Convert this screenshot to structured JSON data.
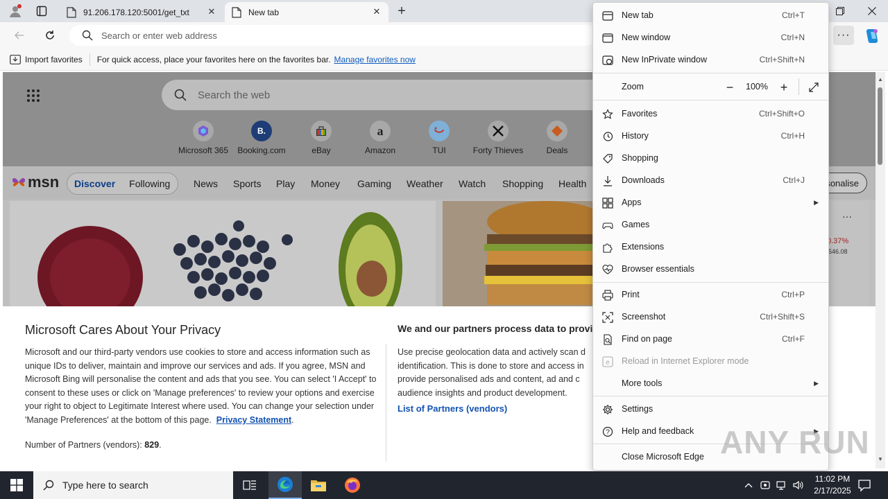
{
  "browser": {
    "tabs": [
      {
        "title": "91.206.178.120:5001/get_txt",
        "active": false
      },
      {
        "title": "New tab",
        "active": true
      }
    ],
    "address_placeholder": "Search or enter web address",
    "favorites_bar": {
      "import_label": "Import favorites",
      "hint_text": "For quick access, place your favorites here on the favorites bar.",
      "manage_link": "Manage favorites now"
    }
  },
  "msn": {
    "search_placeholder": "Search the web",
    "quick_links": [
      {
        "label": "Microsoft 365",
        "icon": "microsoft-365-icon"
      },
      {
        "label": "Booking.com",
        "icon": "booking-icon",
        "glyph": "B."
      },
      {
        "label": "eBay",
        "icon": "ebay-icon"
      },
      {
        "label": "Amazon",
        "icon": "amazon-icon",
        "glyph": "a"
      },
      {
        "label": "TUI",
        "icon": "tui-icon"
      },
      {
        "label": "Forty Thieves",
        "icon": "forty-thieves-icon"
      },
      {
        "label": "Deals",
        "icon": "deals-icon"
      }
    ],
    "logo": "msn",
    "pill": {
      "discover": "Discover",
      "following": "Following"
    },
    "nav_items": [
      "News",
      "Sports",
      "Play",
      "Money",
      "Gaming",
      "Weather",
      "Watch",
      "Shopping",
      "Health"
    ],
    "personalise_label": "rsonalise",
    "stock": {
      "change": "0.37%",
      "value": "546.08"
    }
  },
  "privacy": {
    "title": "Microsoft Cares About Your Privacy",
    "body": "Microsoft and our third-party vendors use cookies to store and access information such as unique IDs to deliver, maintain and improve our services and ads. If you agree, MSN and Microsoft Bing will personalise the content and ads that you see. You can select 'I Accept' to consent to these uses or click on 'Manage preferences' to review your options and exercise your right to object to Legitimate Interest where used.  You can change your selection under 'Manage Preferences' at the bottom of this page.",
    "privacy_link": "Privacy Statement",
    "partners_label": "Number of Partners (vendors):",
    "partners_count": "829",
    "title2": "We and our partners process data to provide:",
    "body2_lines": [
      "Use precise geolocation data and actively scan d",
      "identification. This is done to store and access in",
      "provide personalised ads and content, ad and c",
      "audience insights and product development."
    ],
    "partners_link": "List of Partners (vendors)"
  },
  "menu": {
    "items": [
      {
        "label": "New tab",
        "shortcut": "Ctrl+T",
        "icon": "new-tab-icon"
      },
      {
        "label": "New window",
        "shortcut": "Ctrl+N",
        "icon": "new-window-icon"
      },
      {
        "label": "New InPrivate window",
        "shortcut": "Ctrl+Shift+N",
        "icon": "inprivate-icon"
      },
      {
        "label": "Favorites",
        "shortcut": "Ctrl+Shift+O",
        "icon": "favorites-icon"
      },
      {
        "label": "History",
        "shortcut": "Ctrl+H",
        "icon": "history-icon"
      },
      {
        "label": "Shopping",
        "shortcut": "",
        "icon": "shopping-icon"
      },
      {
        "label": "Downloads",
        "shortcut": "Ctrl+J",
        "icon": "downloads-icon"
      },
      {
        "label": "Apps",
        "shortcut": "",
        "icon": "apps-icon"
      },
      {
        "label": "Games",
        "shortcut": "",
        "icon": "games-icon"
      },
      {
        "label": "Extensions",
        "shortcut": "",
        "icon": "extensions-icon"
      },
      {
        "label": "Browser essentials",
        "shortcut": "",
        "icon": "browser-essentials-icon"
      },
      {
        "label": "Print",
        "shortcut": "Ctrl+P",
        "icon": "print-icon"
      },
      {
        "label": "Screenshot",
        "shortcut": "Ctrl+Shift+S",
        "icon": "screenshot-icon"
      },
      {
        "label": "Find on page",
        "shortcut": "Ctrl+F",
        "icon": "find-icon"
      },
      {
        "label": "Reload in Internet Explorer mode",
        "shortcut": "",
        "icon": "ie-mode-icon"
      },
      {
        "label": "More tools",
        "shortcut": "",
        "icon": ""
      },
      {
        "label": "Settings",
        "shortcut": "",
        "icon": "settings-icon"
      },
      {
        "label": "Help and feedback",
        "shortcut": "",
        "icon": "help-icon"
      },
      {
        "label": "Close Microsoft Edge",
        "shortcut": "",
        "icon": ""
      }
    ],
    "zoom": {
      "label": "Zoom",
      "value": "100%"
    }
  },
  "watermark": "ANY RUN",
  "taskbar": {
    "search_placeholder": "Type here to search",
    "time": "11:02 PM",
    "date": "2/17/2025"
  },
  "colors": {
    "link": "#0f5bbd",
    "privacy_link": "#1352b1",
    "taskbar": "#21252e",
    "stock_red": "#a32323"
  }
}
